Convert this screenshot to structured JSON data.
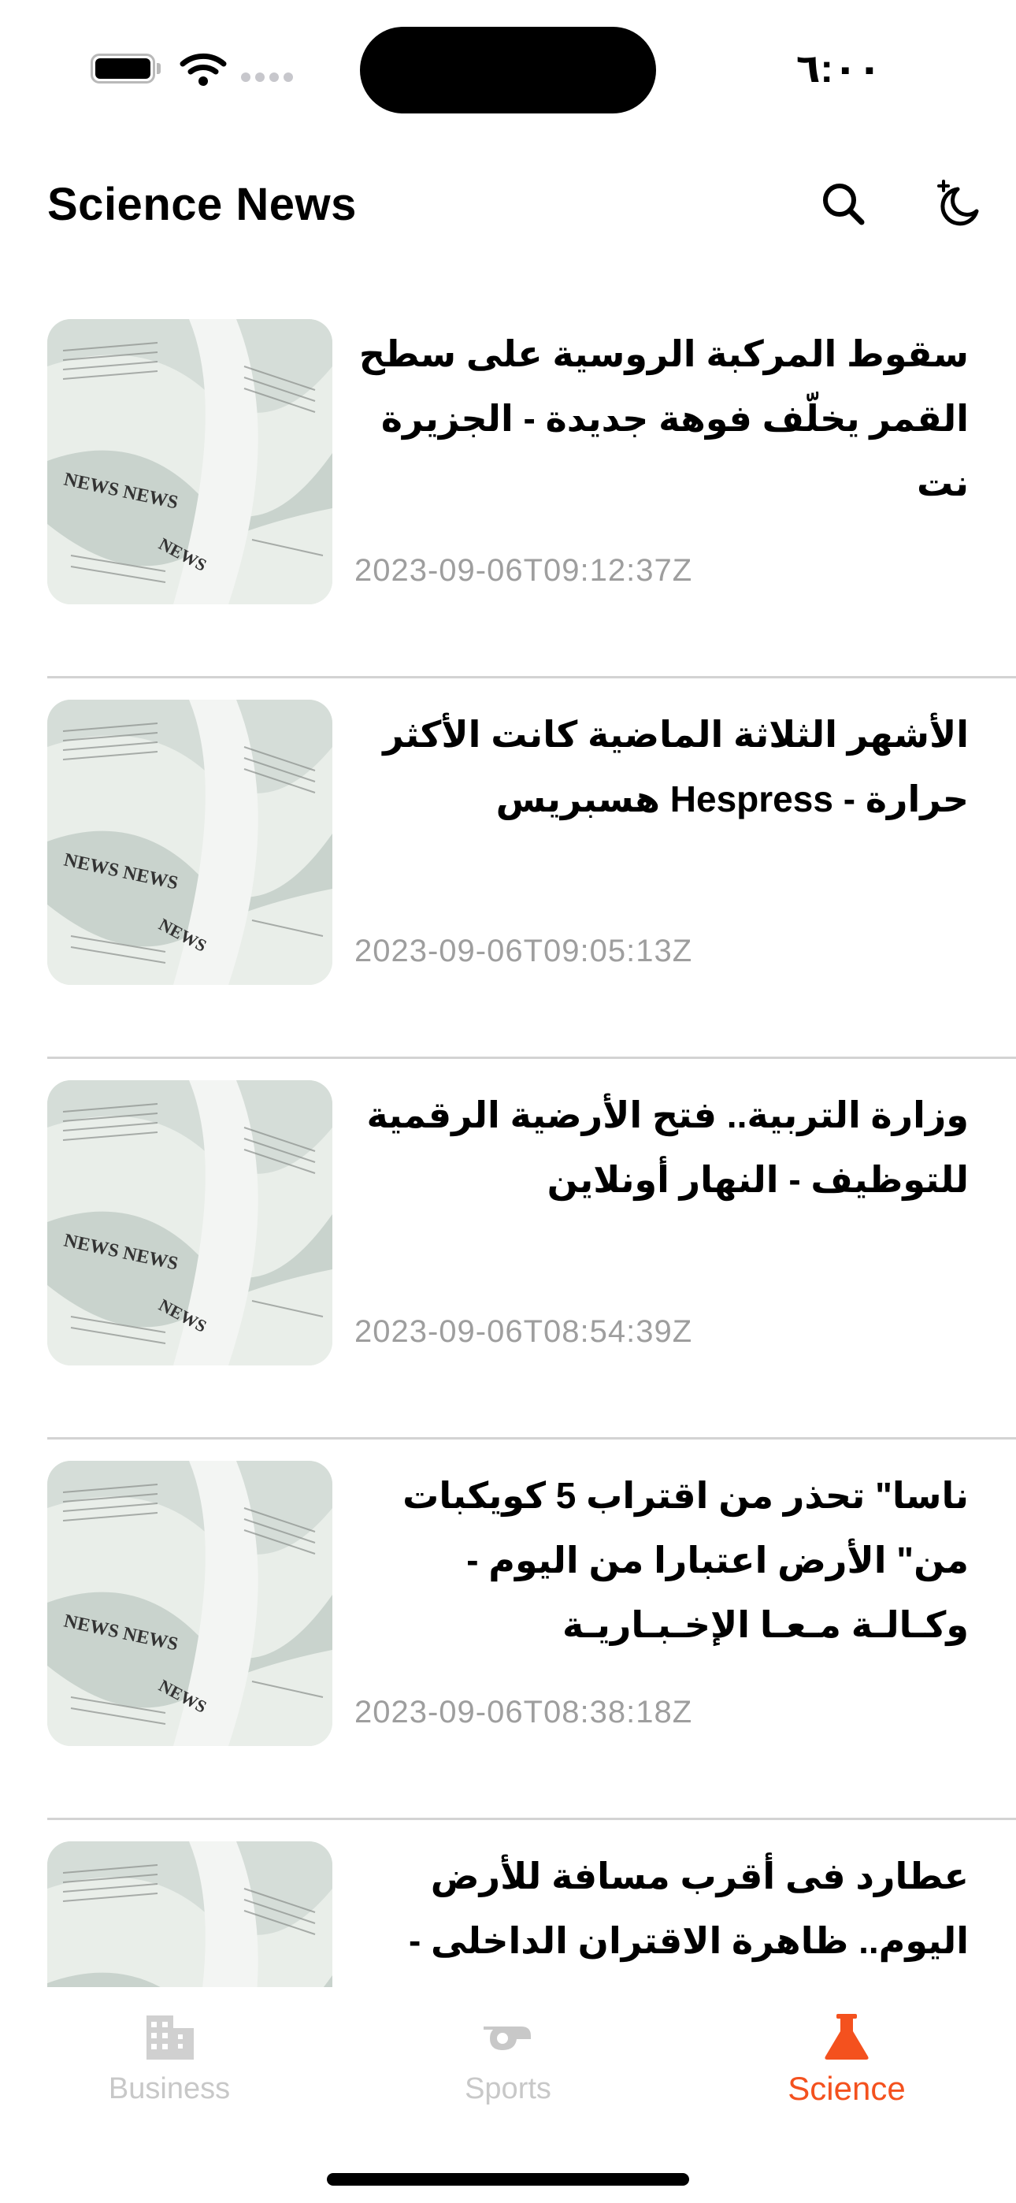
{
  "status_bar": {
    "time": "٦:٠٠",
    "icons": [
      "battery-icon",
      "wifi-icon",
      "signal-icon"
    ]
  },
  "header": {
    "title": "Science News",
    "actions": [
      "search-icon",
      "dark-mode-icon"
    ]
  },
  "articles": [
    {
      "title": "سقوط المركبة الروسية على سطح القمر يخلّف فوهة جديدة - الجزيرة نت",
      "date": "2023-09-06T09:12:37Z"
    },
    {
      "title": "الأشهر الثلاثة الماضية كانت الأكثر حرارة - Hespress هسبريس",
      "date": "2023-09-06T09:05:13Z"
    },
    {
      "title": "وزارة التربية.. فتح الأرضية الرقمية للتوظيف - النهار أونلاين",
      "date": "2023-09-06T08:54:39Z"
    },
    {
      "title": "ناسا\" تحذر من اقتراب 5 كويكبات من\" الأرض اعتبارا من اليوم - وكـالـة مـعـا الإخـبـاريـة",
      "date": "2023-09-06T08:38:18Z"
    },
    {
      "title": "عطارد فى أقرب مسافة للأرض اليوم.. ظاهرة الاقتران الداخلى - اليوم السابع",
      "date": ""
    }
  ],
  "tabs": [
    {
      "label": "Business",
      "icon": "building-icon",
      "active": false
    },
    {
      "label": "Sports",
      "icon": "whistle-icon",
      "active": false
    },
    {
      "label": "Science",
      "icon": "flask-icon",
      "active": true
    }
  ],
  "colors": {
    "accent": "#f4511e",
    "inactive_tab": "#c8c8c8",
    "date_text": "#9e9e9e",
    "divider": "#d3d3d3"
  }
}
